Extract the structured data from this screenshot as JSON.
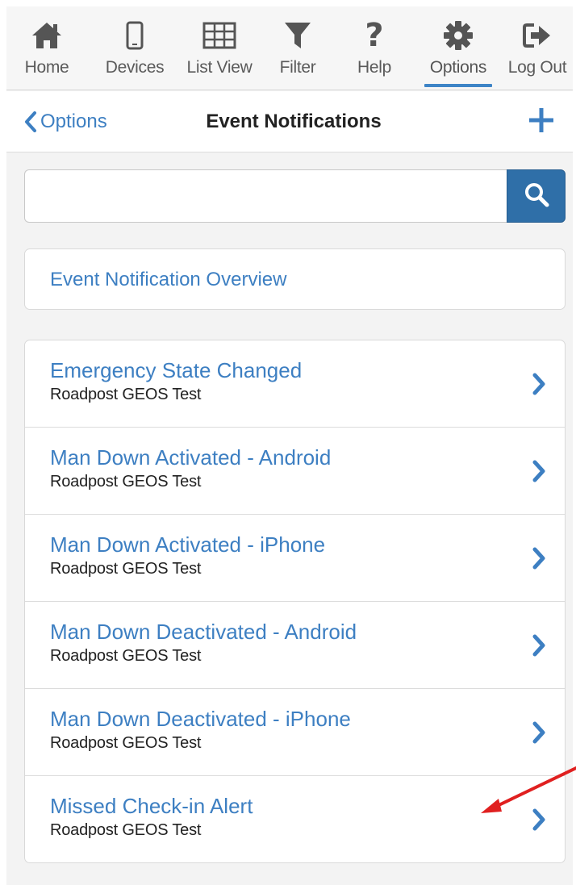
{
  "toolbar": {
    "items": [
      {
        "label": "Home",
        "icon": "home-icon"
      },
      {
        "label": "Devices",
        "icon": "mobile-device-icon"
      },
      {
        "label": "List View",
        "icon": "table-grid-icon"
      },
      {
        "label": "Filter",
        "icon": "funnel-filter-icon"
      },
      {
        "label": "Help",
        "icon": "question-mark-icon"
      },
      {
        "label": "Options",
        "icon": "gear-icon",
        "active": true
      },
      {
        "label": "Log Out",
        "icon": "sign-out-icon"
      }
    ]
  },
  "header": {
    "back_label": "Options",
    "title": "Event Notifications",
    "add_icon": "plus-icon"
  },
  "search": {
    "value": "",
    "placeholder": "",
    "button_icon": "search-icon"
  },
  "overview": {
    "label": "Event Notification Overview"
  },
  "notifications": [
    {
      "title": "Emergency State Changed",
      "subtitle": "Roadpost GEOS Test"
    },
    {
      "title": "Man Down Activated - Android",
      "subtitle": "Roadpost GEOS Test"
    },
    {
      "title": "Man Down Activated - iPhone",
      "subtitle": "Roadpost GEOS Test"
    },
    {
      "title": "Man Down Deactivated - Android",
      "subtitle": "Roadpost GEOS Test"
    },
    {
      "title": "Man Down Deactivated - iPhone",
      "subtitle": "Roadpost GEOS Test"
    },
    {
      "title": "Missed Check-in Alert",
      "subtitle": "Roadpost GEOS Test"
    }
  ],
  "colors": {
    "accent": "#3d7fc2",
    "search_button": "#2f6fa8",
    "icon_gray": "#555555",
    "annotation_arrow": "#e02020"
  }
}
